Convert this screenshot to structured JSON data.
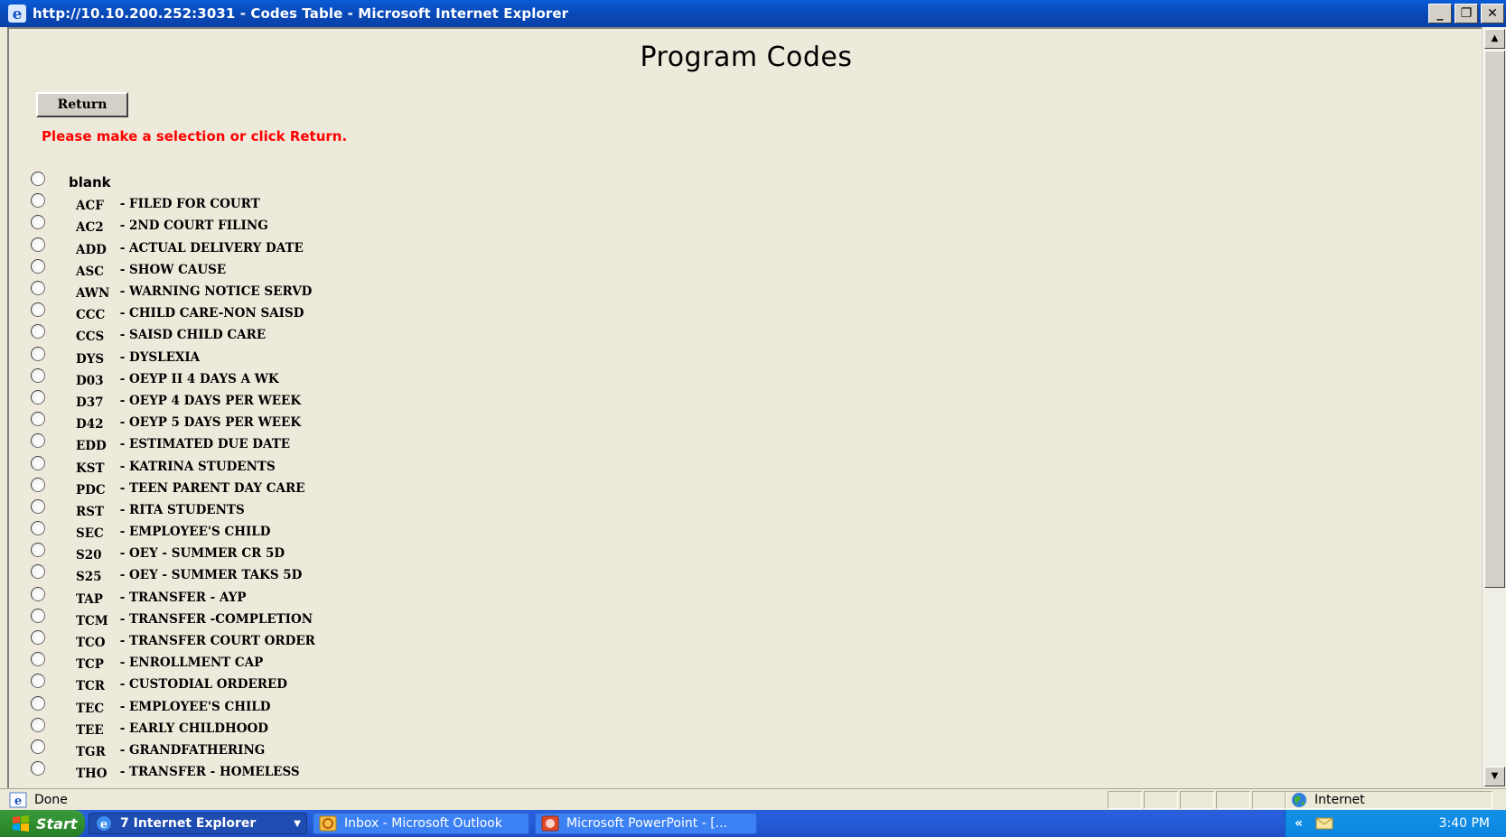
{
  "window": {
    "title": "http://10.10.200.252:3031 - Codes Table - Microsoft Internet Explorer",
    "controls": {
      "minimize": "_",
      "restore": "❐",
      "close": "✕"
    }
  },
  "page": {
    "title": "Program Codes",
    "return_label": "Return",
    "prompt": "Please make a selection or click Return."
  },
  "codes": [
    {
      "code": "",
      "desc": "blank"
    },
    {
      "code": "ACF",
      "desc": "FILED FOR COURT"
    },
    {
      "code": "AC2",
      "desc": "2ND COURT FILING"
    },
    {
      "code": "ADD",
      "desc": "ACTUAL DELIVERY DATE"
    },
    {
      "code": "ASC",
      "desc": "SHOW CAUSE"
    },
    {
      "code": "AWN",
      "desc": "WARNING NOTICE SERVD"
    },
    {
      "code": "CCC",
      "desc": "CHILD CARE-NON SAISD"
    },
    {
      "code": "CCS",
      "desc": "SAISD CHILD CARE"
    },
    {
      "code": "DYS",
      "desc": "DYSLEXIA"
    },
    {
      "code": "D03",
      "desc": "OEYP II 4 DAYS A WK"
    },
    {
      "code": "D37",
      "desc": "OEYP 4 DAYS PER WEEK"
    },
    {
      "code": "D42",
      "desc": "OEYP 5 DAYS PER WEEK"
    },
    {
      "code": "EDD",
      "desc": "ESTIMATED DUE DATE"
    },
    {
      "code": "KST",
      "desc": "KATRINA STUDENTS"
    },
    {
      "code": "PDC",
      "desc": "TEEN PARENT DAY CARE"
    },
    {
      "code": "RST",
      "desc": "RITA STUDENTS"
    },
    {
      "code": "SEC",
      "desc": "EMPLOYEE'S CHILD"
    },
    {
      "code": "S20",
      "desc": "OEY - SUMMER CR 5D"
    },
    {
      "code": "S25",
      "desc": "OEY - SUMMER TAKS 5D"
    },
    {
      "code": "TAP",
      "desc": "TRANSFER - AYP"
    },
    {
      "code": "TCM",
      "desc": "TRANSFER -COMPLETION"
    },
    {
      "code": "TCO",
      "desc": "TRANSFER COURT ORDER"
    },
    {
      "code": "TCP",
      "desc": "ENROLLMENT CAP"
    },
    {
      "code": "TCR",
      "desc": "CUSTODIAL ORDERED"
    },
    {
      "code": "TEC",
      "desc": "EMPLOYEE'S CHILD"
    },
    {
      "code": "TEE",
      "desc": "EARLY CHILDHOOD"
    },
    {
      "code": "TGR",
      "desc": "GRANDFATHERING"
    },
    {
      "code": "THO",
      "desc": "TRANSFER - HOMELESS"
    }
  ],
  "statusbar": {
    "status": "Done",
    "zone": "Internet"
  },
  "taskbar": {
    "start": "Start",
    "tasks": [
      {
        "label": "7 Internet Explorer",
        "icon": "ie-icon"
      },
      {
        "label": "Inbox - Microsoft Outlook",
        "icon": "outlook-icon"
      },
      {
        "label": "Microsoft PowerPoint - [...",
        "icon": "powerpoint-icon"
      }
    ],
    "tray_chevron": "«",
    "clock": "3:40 PM"
  },
  "colors": {
    "titlebar": "#0a5cd8",
    "page_bg": "#eeeadb",
    "prompt": "#ff0000",
    "taskbar": "#245edb",
    "start": "#2f8f2f"
  }
}
